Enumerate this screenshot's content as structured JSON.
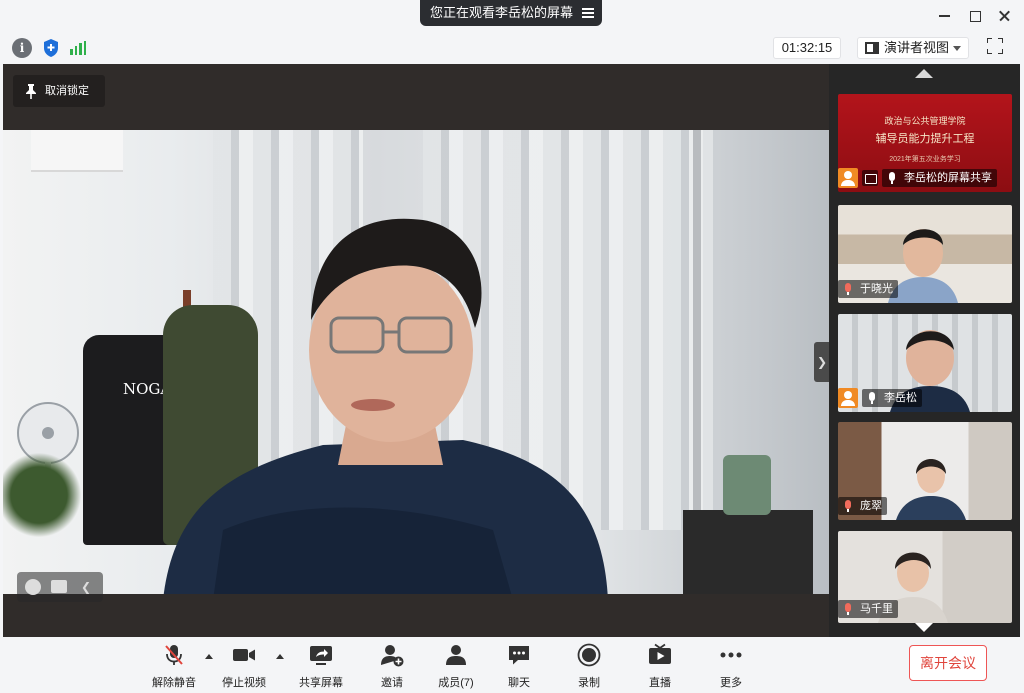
{
  "window": {
    "sharing_banner": "您正在观看李岳松的屏幕"
  },
  "toolbar": {
    "timer": "01:32:15",
    "view_mode": "演讲者视图"
  },
  "stage": {
    "unlock_label": "取消锁定"
  },
  "sidepanel": {
    "tiles": [
      {
        "name": "李岳松的屏幕共享",
        "type": "screen-share",
        "slide_lines": [
          "政治与公共管理学院",
          "辅导员能力提升工程",
          "2021年第五次业务学习"
        ]
      },
      {
        "name": "于晓光",
        "type": "camera",
        "mic": "muted"
      },
      {
        "name": "李岳松",
        "type": "camera",
        "mic": "on",
        "host": true
      },
      {
        "name": "庞翠",
        "type": "camera",
        "mic": "muted"
      },
      {
        "name": "马千里",
        "type": "camera",
        "mic": "muted"
      }
    ]
  },
  "bottombar": {
    "controls": [
      {
        "label": "解除静音",
        "icon": "mic-muted-icon"
      },
      {
        "label": "停止视频",
        "icon": "video-camera-icon"
      },
      {
        "label": "共享屏幕",
        "icon": "share-screen-icon"
      },
      {
        "label": "邀请",
        "icon": "invite-icon"
      },
      {
        "label": "成员(7)",
        "icon": "members-icon"
      },
      {
        "label": "聊天",
        "icon": "chat-icon"
      },
      {
        "label": "录制",
        "icon": "record-icon"
      },
      {
        "label": "直播",
        "icon": "live-icon"
      },
      {
        "label": "更多",
        "icon": "more-icon"
      }
    ],
    "leave_label": "离开会议"
  },
  "colors": {
    "leave_red": "#e0453c",
    "host_orange": "#f08a24",
    "signal_green": "#2fb04b",
    "shield_blue": "#1e6fd9"
  }
}
